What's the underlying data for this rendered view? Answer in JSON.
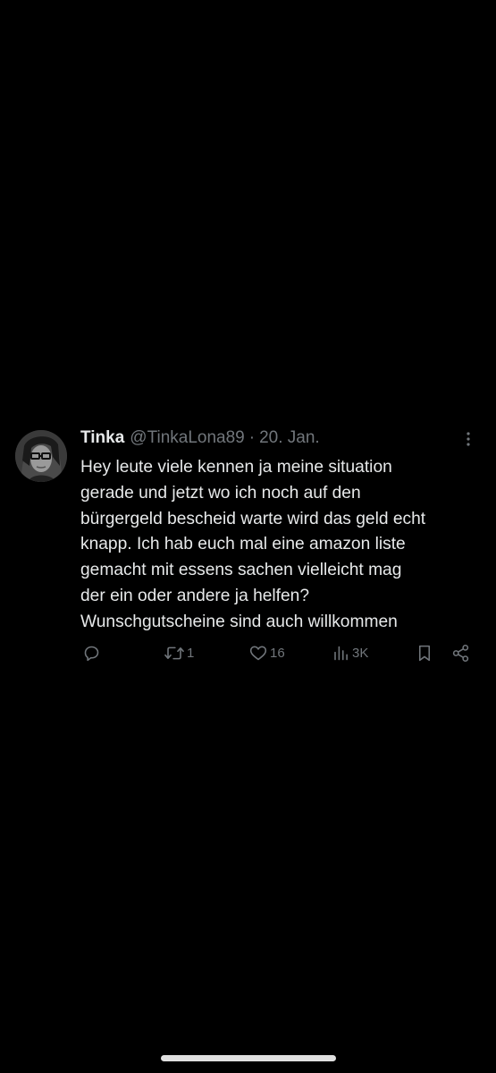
{
  "tweet": {
    "author_name": "Tinka",
    "handle": "@TinkaLona89",
    "separator": "·",
    "date": "20. Jan.",
    "text": "Hey leute viele kennen ja meine situation\ngerade und jetzt wo ich noch auf den\nbürgergeld bescheid warte wird das geld echt\nknapp. Ich hab euch mal eine amazon liste\ngemacht mit essens sachen vielleicht mag\nder ein oder andere ja helfen?\nWunschgutscheine sind auch willkommen"
  },
  "actions": {
    "reply_icon": "reply-icon",
    "retweet_icon": "retweet-icon",
    "retweet_count": "1",
    "like_icon": "heart-icon",
    "like_count": "16",
    "views_icon": "views-icon",
    "views_count": "3K",
    "bookmark_icon": "bookmark-icon",
    "share_icon": "share-icon"
  },
  "colors": {
    "background": "#000000",
    "text": "#e7e9ea",
    "secondary": "#71767b"
  }
}
